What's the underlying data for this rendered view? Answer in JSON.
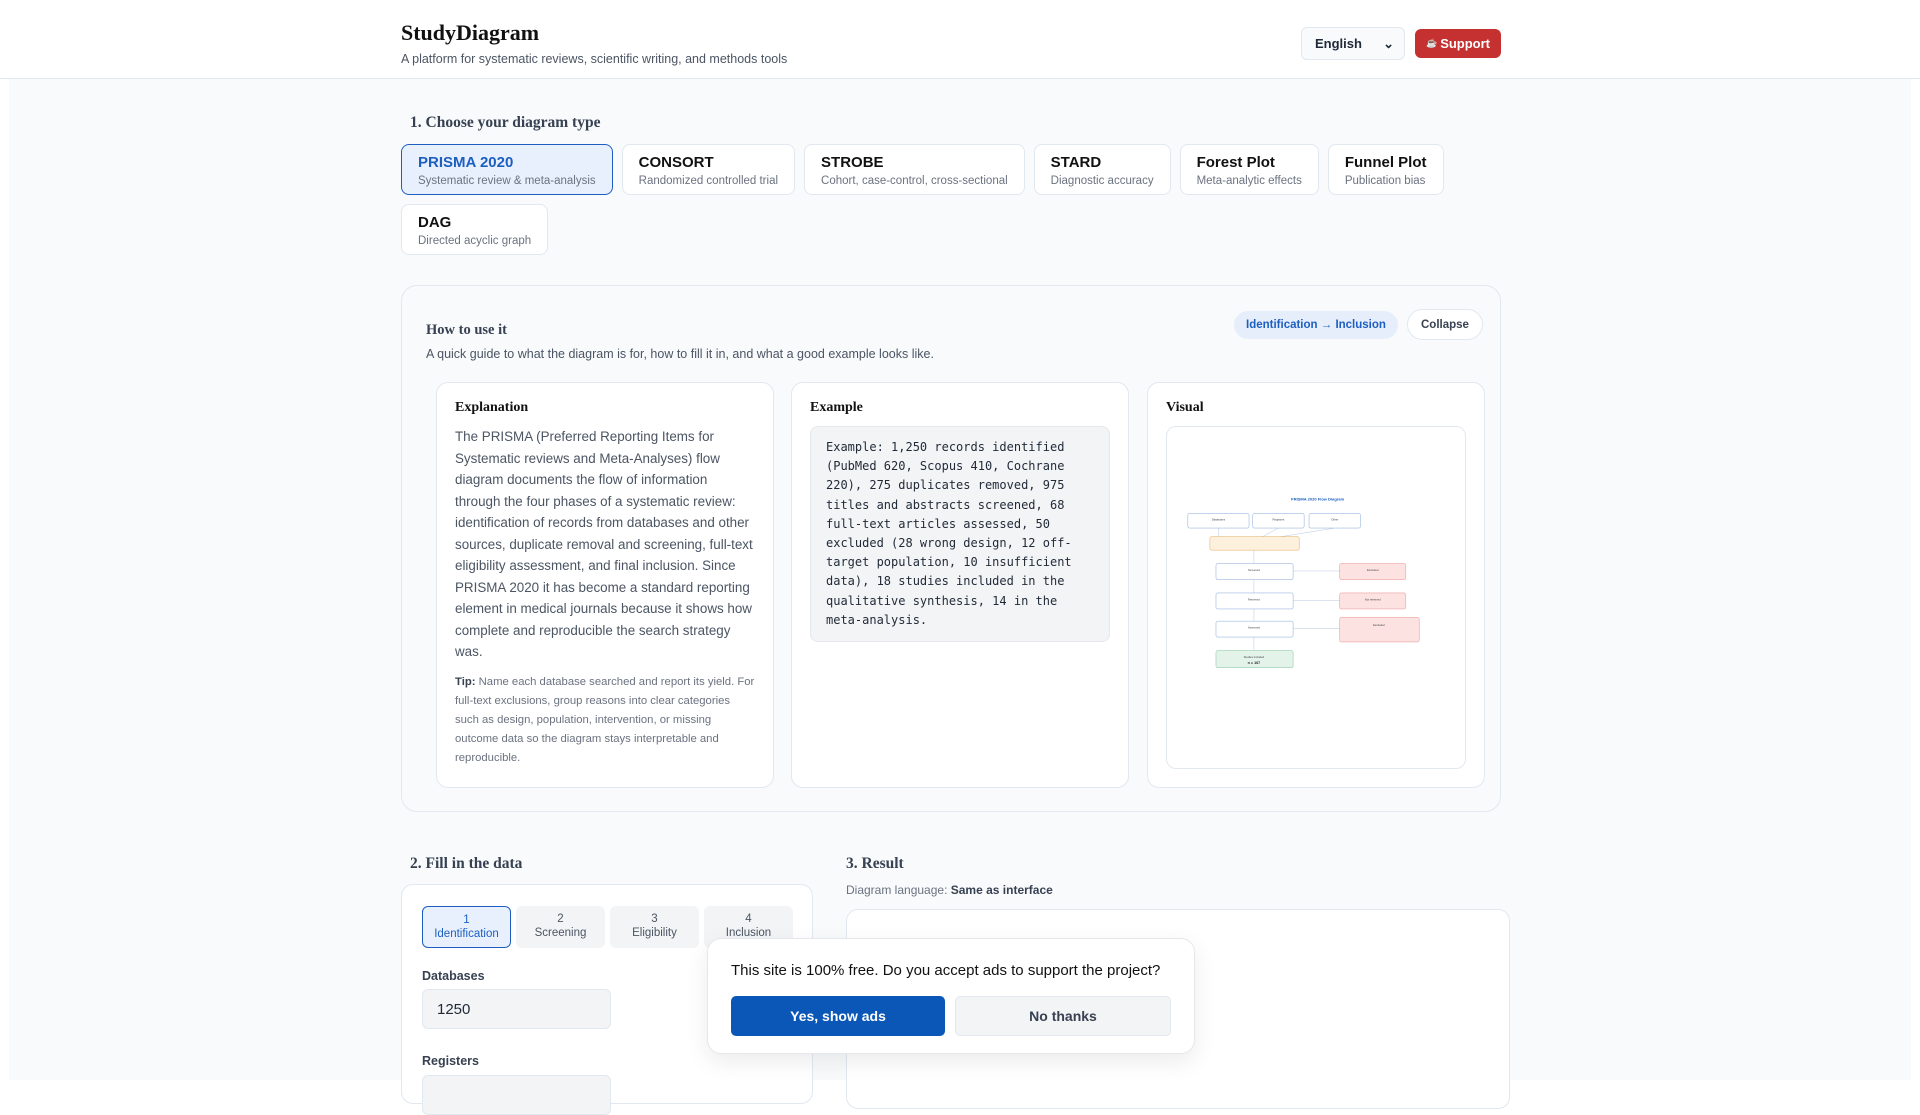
{
  "header": {
    "title": "StudyDiagram",
    "subtitle": "A platform for systematic reviews, scientific writing, and methods tools",
    "language": "English",
    "support_label": "Support",
    "support_icon": "coffee-icon"
  },
  "section1": {
    "title": "1. Choose your diagram type",
    "types": [
      {
        "name": "PRISMA 2020",
        "desc": "Systematic review & meta-analysis",
        "active": true
      },
      {
        "name": "CONSORT",
        "desc": "Randomized controlled trial"
      },
      {
        "name": "STROBE",
        "desc": "Cohort, case-control, cross-sectional"
      },
      {
        "name": "STARD",
        "desc": "Diagnostic accuracy"
      },
      {
        "name": "Forest Plot",
        "desc": "Meta-analytic effects"
      },
      {
        "name": "Funnel Plot",
        "desc": "Publication bias"
      },
      {
        "name": "DAG",
        "desc": "Directed acyclic graph"
      }
    ]
  },
  "guide": {
    "title": "How to use it",
    "description": "A quick guide to what the diagram is for, how to fill it in, and what a good example looks like.",
    "badge": "Identification → Inclusion",
    "collapse_label": "Collapse",
    "explanation_title": "Explanation",
    "explanation": "The PRISMA (Preferred Reporting Items for Systematic reviews and Meta-Analyses) flow diagram documents the flow of information through the four phases of a systematic review: identification of records from databases and other sources, duplicate removal and screening, full-text eligibility assessment, and final inclusion. Since PRISMA 2020 it has become a standard reporting element in medical journals because it shows how complete and reproducible the search strategy was.",
    "tip_label": "Tip:",
    "tip": "Name each database searched and report its yield. For full-text exclusions, group reasons into clear categories such as design, population, intervention, or missing outcome data so the diagram stays interpretable and reproducible.",
    "example_title": "Example",
    "example": "Example: 1,250 records identified (PubMed 620, Scopus 410, Cochrane 220), 275 duplicates removed, 975 titles and abstracts screened, 68 full-text articles assessed, 50 excluded (28 wrong design, 12 off-target population, 10 insufficient data), 18 studies included in the qualitative synthesis, 14 in the meta-analysis.",
    "visual_title": "Visual",
    "visual": {
      "title": "PRISMA 2020 Flow Diagram",
      "databases": "Databases",
      "registers": "Registers",
      "other": "Other",
      "screened": "Screened",
      "excluded": "Excluded",
      "retrieved": "Retrieved",
      "not_retrieved": "Not retrieved",
      "assessed": "Assessed",
      "included": "Studies included",
      "included_n": "n = 107"
    }
  },
  "section2": {
    "title": "2. Fill in the data",
    "steps": [
      {
        "num": "1",
        "label": "Identification",
        "active": true
      },
      {
        "num": "2",
        "label": "Screening"
      },
      {
        "num": "3",
        "label": "Eligibility"
      },
      {
        "num": "4",
        "label": "Inclusion"
      }
    ],
    "databases_label": "Databases",
    "databases_value": "1250",
    "registers_label": "Registers"
  },
  "section3": {
    "title": "3. Result",
    "lang_label": "Diagram language:",
    "lang_value": "Same as interface"
  },
  "modal": {
    "question": "This site is 100% free. Do you accept ads to support the project?",
    "yes": "Yes, show ads",
    "no": "No thanks"
  }
}
